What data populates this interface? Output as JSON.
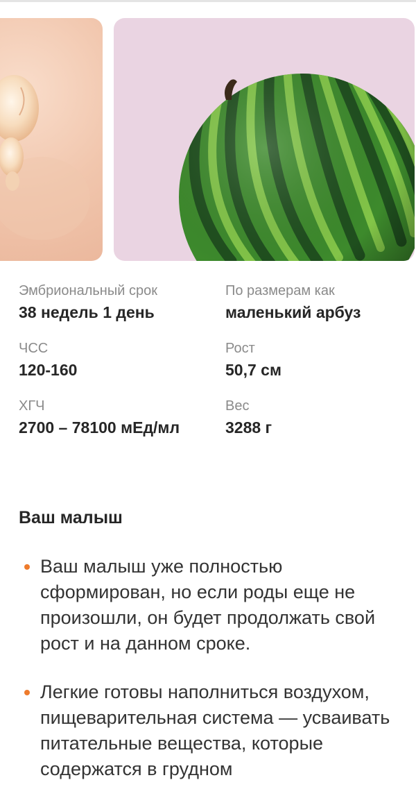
{
  "images": {
    "embryo": "embryo-illustration",
    "fruit": "watermelon-photo"
  },
  "colors": {
    "accent": "#ee7b2c",
    "fruit_card_bg": "#ead4e2",
    "label": "#8a8a8a"
  },
  "stats": {
    "term": {
      "label": "Эмбриональный срок",
      "value": "38 недель 1 день"
    },
    "size": {
      "label": "По размерам как",
      "value": "маленький арбуз"
    },
    "hr": {
      "label": "ЧСС",
      "value": "120-160"
    },
    "height": {
      "label": "Рост",
      "value": "50,7 см"
    },
    "hcg": {
      "label": "ХГЧ",
      "value": "2700 – 78100 мЕд/мл"
    },
    "weight": {
      "label": "Вес",
      "value": "3288 г"
    }
  },
  "section": {
    "title": "Ваш малыш",
    "bullets": [
      "Ваш малыш уже полностью сформирован, но если роды еще не произошли, он будет продолжать свой рост и на данном сроке.",
      "Легкие готовы наполниться воздухом, пищеварительная система — усваивать питательные вещества, которые содержатся в грудном"
    ]
  }
}
